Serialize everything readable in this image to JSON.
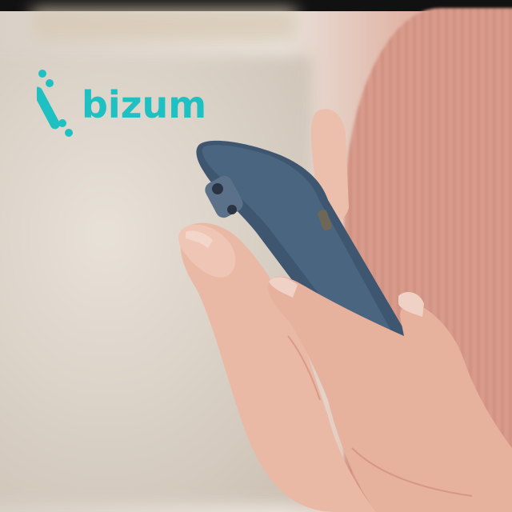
{
  "logo": {
    "text": "bizum",
    "icon": "bizum-logo-icon",
    "color": "#1fc0c2"
  },
  "photo": {
    "icons": [
      "smartphone",
      "hand"
    ]
  }
}
